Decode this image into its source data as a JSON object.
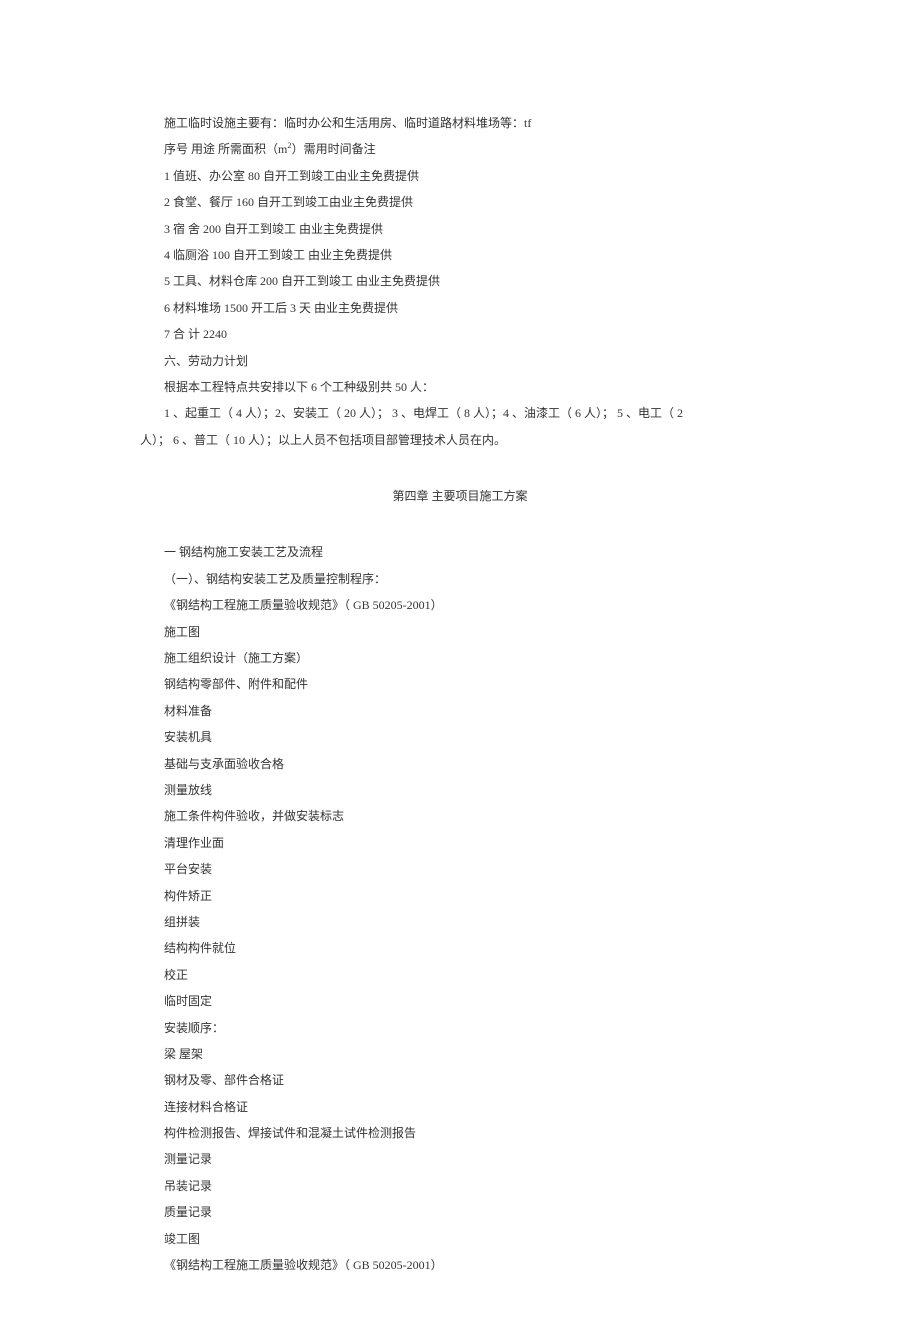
{
  "intro": "施工临时设施主要有：临时办公和生活用房、临时道路材料堆场等：tf",
  "tableHeader": "序号 用途   所需面积（m2）需用时间备注",
  "tableRows": [
    "1    值班、办公室 80 自开工到竣工由业主免费提供",
    "2    食堂、餐厅 160 自开工到竣工由业主免费提供",
    "3    宿 舍 200 自开工到竣工  由业主免费提供",
    "4    临厕浴 100 自开工到竣工  由业主免费提供",
    "5    工具、材料仓库 200 自开工到竣工  由业主免费提供",
    "6    材料堆场 1500 开工后 3 天  由业主免费提供",
    "7    合 计 2240"
  ],
  "section6Title": "六、劳动力计划",
  "section6Body": "根据本工程特点共安排以下 6 个工种级别共 50 人：",
  "workersLine1": "1 、起重工（ 4 人）；2、安装工（ 20 人）； 3 、电焊工（ 8 人）；4 、油漆工（ 6 人）； 5 、电工（ 2",
  "workersLine2": "人）； 6 、普工（ 10 人）；以上人员不包括项目部管理技术人员在内。",
  "chapterTitle": "第四章 主要项目施工方案",
  "s1Title": "一 钢结构施工安装工艺及流程",
  "s1SubTitle": "（一）、钢结构安装工艺及质量控制程序：",
  "processList": [
    "《钢结构工程施工质量验收规范》（ GB 50205-2001）",
    "施工图",
    "施工组织设计（施工方案）",
    "钢结构零部件、附件和配件",
    "材料准备",
    "安装机具",
    "基础与支承面验收合格",
    "测量放线",
    "施工条件构件验收，并做安装标志",
    "清理作业面",
    "平台安装",
    "构件矫正",
    "组拼装",
    "结构构件就位",
    "校正",
    "临时固定",
    "安装顺序：",
    "梁 屋架",
    "钢材及零、部件合格证",
    "连接材料合格证",
    "构件检测报告、焊接试件和混凝土试件检测报告",
    "测量记录",
    "吊装记录",
    "质量记录",
    "竣工图",
    "《钢结构工程施工质量验收规范》（ GB 50205-2001）"
  ]
}
